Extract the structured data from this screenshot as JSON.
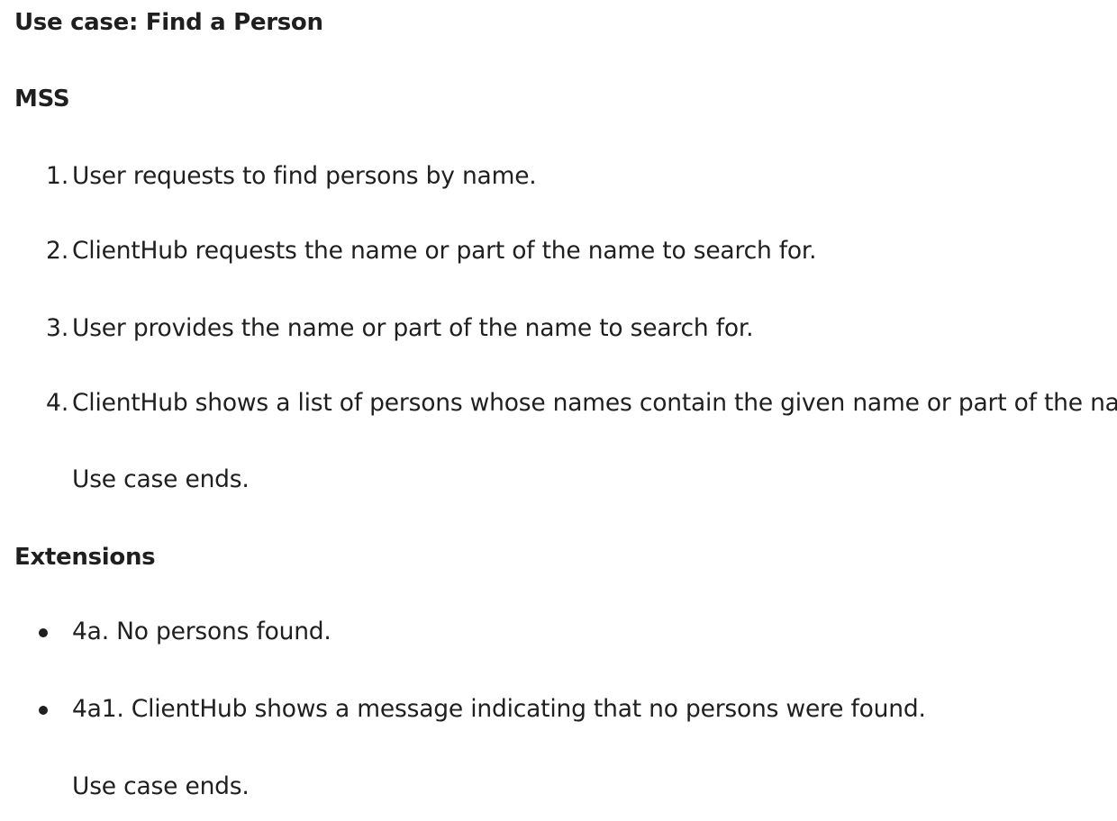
{
  "title": "Use case: Find a Person",
  "mss_heading": "MSS",
  "mss_steps": [
    {
      "number": "1.",
      "text": "User requests to find persons by name."
    },
    {
      "number": "2.",
      "text": "ClientHub requests the name or part of the name to search for."
    },
    {
      "number": "3.",
      "text": "User provides the name or part of the name to search for."
    },
    {
      "number": "4.",
      "text": "ClientHub shows a list of persons whose names contain the given name or part of the name."
    }
  ],
  "mss_end": "Use case ends.",
  "extensions_heading": "Extensions",
  "extensions": [
    {
      "text": "4a. No persons found."
    },
    {
      "text": "4a1. ClientHub shows a message indicating that no persons were found."
    }
  ],
  "extensions_end": "Use case ends."
}
